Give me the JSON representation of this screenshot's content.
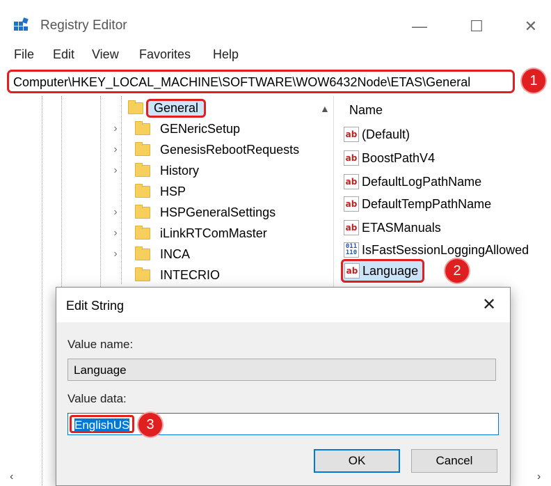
{
  "window": {
    "title": "Registry Editor",
    "controls": {
      "minimize": "—",
      "maximize": "☐",
      "close": "✕"
    }
  },
  "menu": [
    "File",
    "Edit",
    "View",
    "Favorites",
    "Help"
  ],
  "address": "Computer\\HKEY_LOCAL_MACHINE\\SOFTWARE\\WOW6432Node\\ETAS\\General",
  "annotations": {
    "step1": "1",
    "step2": "2",
    "step3": "3"
  },
  "tree": {
    "items": [
      {
        "label": "General",
        "expandable": false,
        "selected": true
      },
      {
        "label": "GENericSetup",
        "expandable": true
      },
      {
        "label": "GenesisRebootRequests",
        "expandable": true
      },
      {
        "label": "History",
        "expandable": true
      },
      {
        "label": "HSP",
        "expandable": false
      },
      {
        "label": "HSPGeneralSettings",
        "expandable": true
      },
      {
        "label": "iLinkRTComMaster",
        "expandable": true
      },
      {
        "label": "INCA",
        "expandable": true
      },
      {
        "label": "INTECRIO",
        "expandable": false
      }
    ]
  },
  "list": {
    "header": "Name",
    "items": [
      {
        "label": "(Default)",
        "icon": "ab-string-icon"
      },
      {
        "label": "BoostPathV4",
        "icon": "ab-string-icon"
      },
      {
        "label": "DefaultLogPathName",
        "icon": "ab-string-icon"
      },
      {
        "label": "DefaultTempPathName",
        "icon": "ab-string-icon"
      },
      {
        "label": "ETASManuals",
        "icon": "ab-string-icon"
      },
      {
        "label": "IsFastSessionLoggingAllowed",
        "icon": "binary-dword-icon"
      },
      {
        "label": "Language",
        "icon": "ab-string-icon",
        "selected": true
      }
    ]
  },
  "dialog": {
    "title": "Edit String",
    "close": "✕",
    "value_name_label": "Value name:",
    "value_name": "Language",
    "value_data_label": "Value data:",
    "value_data": "EnglishUS",
    "ok_label": "OK",
    "cancel_label": "Cancel"
  },
  "colors": {
    "annotation_red": "#e02020",
    "selection_blue": "#0078d7",
    "folder_yellow": "#f6cf5c"
  }
}
